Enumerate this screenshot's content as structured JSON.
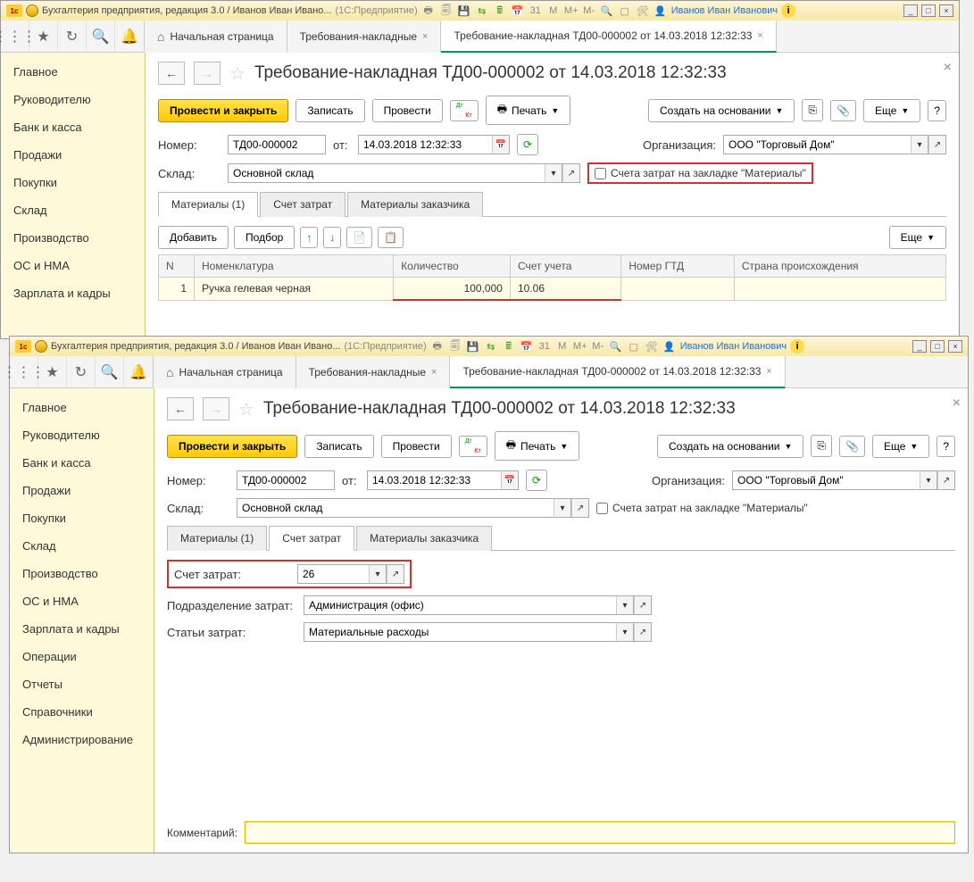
{
  "window1": {
    "title": "Бухгалтерия предприятия, редакция 3.0 / Иванов Иван Ивано...",
    "app_hint": "(1С:Предприятие)",
    "user": "Иванов Иван Иванович",
    "top_tabs": {
      "home": "Начальная страница",
      "tab1": "Требования-накладные",
      "tab2": "Требование-накладная ТД00-000002 от 14.03.2018 12:32:33"
    },
    "sidebar": [
      "Главное",
      "Руководителю",
      "Банк и касса",
      "Продажи",
      "Покупки",
      "Склад",
      "Производство",
      "ОС и НМА",
      "Зарплата и кадры"
    ],
    "doc_title": "Требование-накладная ТД00-000002 от 14.03.2018 12:32:33",
    "btn_primary": "Провести и закрыть",
    "btn_save": "Записать",
    "btn_post": "Провести",
    "btn_print": "Печать",
    "btn_create_based": "Создать на основании",
    "btn_more": "Еще",
    "lbl_number": "Номер:",
    "val_number": "ТД00-000002",
    "lbl_from": "от:",
    "val_date": "14.03.2018 12:32:33",
    "lbl_org": "Организация:",
    "val_org": "ООО \"Торговый Дом\"",
    "lbl_sklad": "Склад:",
    "val_sklad": "Основной склад",
    "chk_label": "Счета затрат на закладке \"Материалы\"",
    "tabs": {
      "t1": "Материалы (1)",
      "t2": "Счет затрат",
      "t3": "Материалы заказчика"
    },
    "tbl_btn_add": "Добавить",
    "tbl_btn_pick": "Подбор",
    "cols": {
      "n": "N",
      "nom": "Номенклатура",
      "qty": "Количество",
      "acc": "Счет учета",
      "gtd": "Номер ГТД",
      "country": "Страна происхождения"
    },
    "row": {
      "n": "1",
      "nom": "Ручка гелевая черная",
      "qty": "100,000",
      "acc": "10.06"
    }
  },
  "window2": {
    "title": "Бухгалтерия предприятия, редакция 3.0 / Иванов Иван Ивано...",
    "app_hint": "(1С:Предприятие)",
    "user": "Иванов Иван Иванович",
    "top_tabs": {
      "home": "Начальная страница",
      "tab1": "Требования-накладные",
      "tab2": "Требование-накладная ТД00-000002 от 14.03.2018 12:32:33"
    },
    "sidebar": [
      "Главное",
      "Руководителю",
      "Банк и касса",
      "Продажи",
      "Покупки",
      "Склад",
      "Производство",
      "ОС и НМА",
      "Зарплата и кадры",
      "Операции",
      "Отчеты",
      "Справочники",
      "Администрирование"
    ],
    "doc_title": "Требование-накладная ТД00-000002 от 14.03.2018 12:32:33",
    "btn_primary": "Провести и закрыть",
    "btn_save": "Записать",
    "btn_post": "Провести",
    "btn_print": "Печать",
    "btn_create_based": "Создать на основании",
    "btn_more": "Еще",
    "lbl_number": "Номер:",
    "val_number": "ТД00-000002",
    "lbl_from": "от:",
    "val_date": "14.03.2018 12:32:33",
    "lbl_org": "Организация:",
    "val_org": "ООО \"Торговый Дом\"",
    "lbl_sklad": "Склад:",
    "val_sklad": "Основной склад",
    "chk_label": "Счета затрат на закладке \"Материалы\"",
    "tabs": {
      "t1": "Материалы (1)",
      "t2": "Счет затрат",
      "t3": "Материалы заказчика"
    },
    "lbl_cost_acc": "Счет затрат:",
    "val_cost_acc": "26",
    "lbl_dept": "Подразделение затрат:",
    "val_dept": "Администрация (офис)",
    "lbl_item": "Статьи затрат:",
    "val_item": "Материальные расходы",
    "lbl_comment": "Комментарий:"
  }
}
